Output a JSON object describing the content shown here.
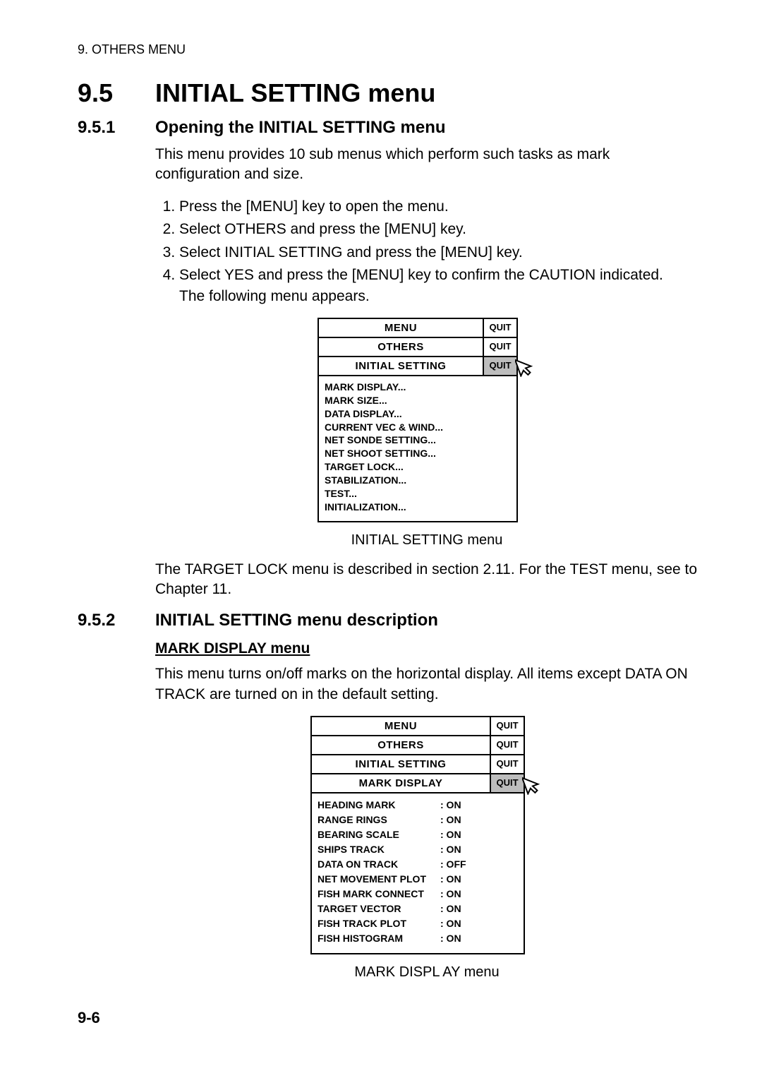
{
  "running_head": "9. OTHERS MENU",
  "section": {
    "num": "9.5",
    "title": "INITIAL SETTING menu"
  },
  "sub1": {
    "num": "9.5.1",
    "title": "Opening the INITIAL SETTING menu",
    "intro": "This menu provides 10 sub menus which perform such tasks as mark configuration and size.",
    "steps": [
      "Press the [MENU] key to open the menu.",
      "Select OTHERS and press the [MENU] key.",
      "Select INITIAL SETTING and press the [MENU] key.",
      "Select YES and press the [MENU] key to confirm the CAUTION indicated."
    ],
    "step_tail": "The following menu appears.",
    "menu1": {
      "rows": [
        {
          "title": "MENU",
          "quit": "QUIT"
        },
        {
          "title": "OTHERS",
          "quit": "QUIT"
        },
        {
          "title": "INITIAL SETTING",
          "quit": "QUIT"
        }
      ],
      "items": [
        "MARK DISPLAY...",
        "MARK SIZE...",
        "DATA DISPLAY...",
        "CURRENT VEC & WIND...",
        "NET SONDE SETTING...",
        "NET SHOOT SETTING...",
        "TARGET LOCK...",
        "STABILIZATION...",
        "TEST...",
        "INITIALIZATION..."
      ],
      "caption": "INITIAL  SETTING menu"
    },
    "after": "The TARGET LOCK menu is described in section 2.11. For the TEST menu, see to Chapter 11."
  },
  "sub2": {
    "num": "9.5.2",
    "title": "INITIAL SETTING menu description",
    "subhead": "MARK DISPLAY menu",
    "intro": "This menu turns on/off marks on the horizontal display. All items except DATA ON TRACK are turned on in the default setting.",
    "menu2": {
      "rows": [
        {
          "title": "MENU",
          "quit": "QUIT"
        },
        {
          "title": "OTHERS",
          "quit": "QUIT"
        },
        {
          "title": "INITIAL SETTING",
          "quit": "QUIT"
        },
        {
          "title": "MARK DISPLAY",
          "quit": "QUIT"
        }
      ],
      "items": [
        {
          "label": "HEADING MARK",
          "value": ": ON"
        },
        {
          "label": "RANGE RINGS",
          "value": ": ON"
        },
        {
          "label": "BEARING SCALE",
          "value": ": ON"
        },
        {
          "label": "SHIPS TRACK",
          "value": ": ON"
        },
        {
          "label": "DATA ON TRACK",
          "value": ": OFF"
        },
        {
          "label": "NET MOVEMENT PLOT",
          "value": ": ON"
        },
        {
          "label": "FISH MARK CONNECT",
          "value": ": ON"
        },
        {
          "label": "TARGET VECTOR",
          "value": ": ON"
        },
        {
          "label": "FISH TRACK PLOT",
          "value": ": ON"
        },
        {
          "label": "FISH HISTOGRAM",
          "value": ": ON"
        }
      ],
      "caption": "MARK DISPL AY menu"
    }
  },
  "page_num": "9-6"
}
